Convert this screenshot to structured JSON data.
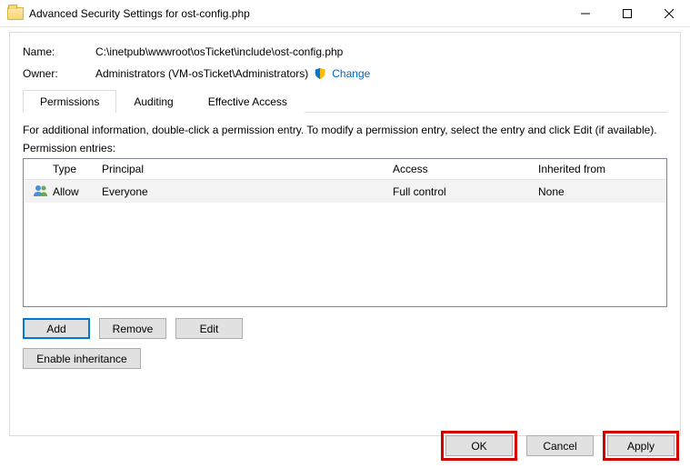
{
  "window": {
    "title": "Advanced Security Settings for ost-config.php"
  },
  "header": {
    "name_label": "Name:",
    "name_value": "C:\\inetpub\\wwwroot\\osTicket\\include\\ost-config.php",
    "owner_label": "Owner:",
    "owner_value": "Administrators (VM-osTicket\\Administrators)",
    "change_link": "Change"
  },
  "tabs": {
    "permissions": "Permissions",
    "auditing": "Auditing",
    "effective_access": "Effective Access"
  },
  "info_text": "For additional information, double-click a permission entry. To modify a permission entry, select the entry and click Edit (if available).",
  "entries_label": "Permission entries:",
  "columns": {
    "type": "Type",
    "principal": "Principal",
    "access": "Access",
    "inherited": "Inherited from"
  },
  "rows": [
    {
      "type": "Allow",
      "principal": "Everyone",
      "access": "Full control",
      "inherited": "None"
    }
  ],
  "buttons": {
    "add": "Add",
    "remove": "Remove",
    "edit": "Edit",
    "enable_inheritance": "Enable inheritance",
    "ok": "OK",
    "cancel": "Cancel",
    "apply": "Apply"
  }
}
